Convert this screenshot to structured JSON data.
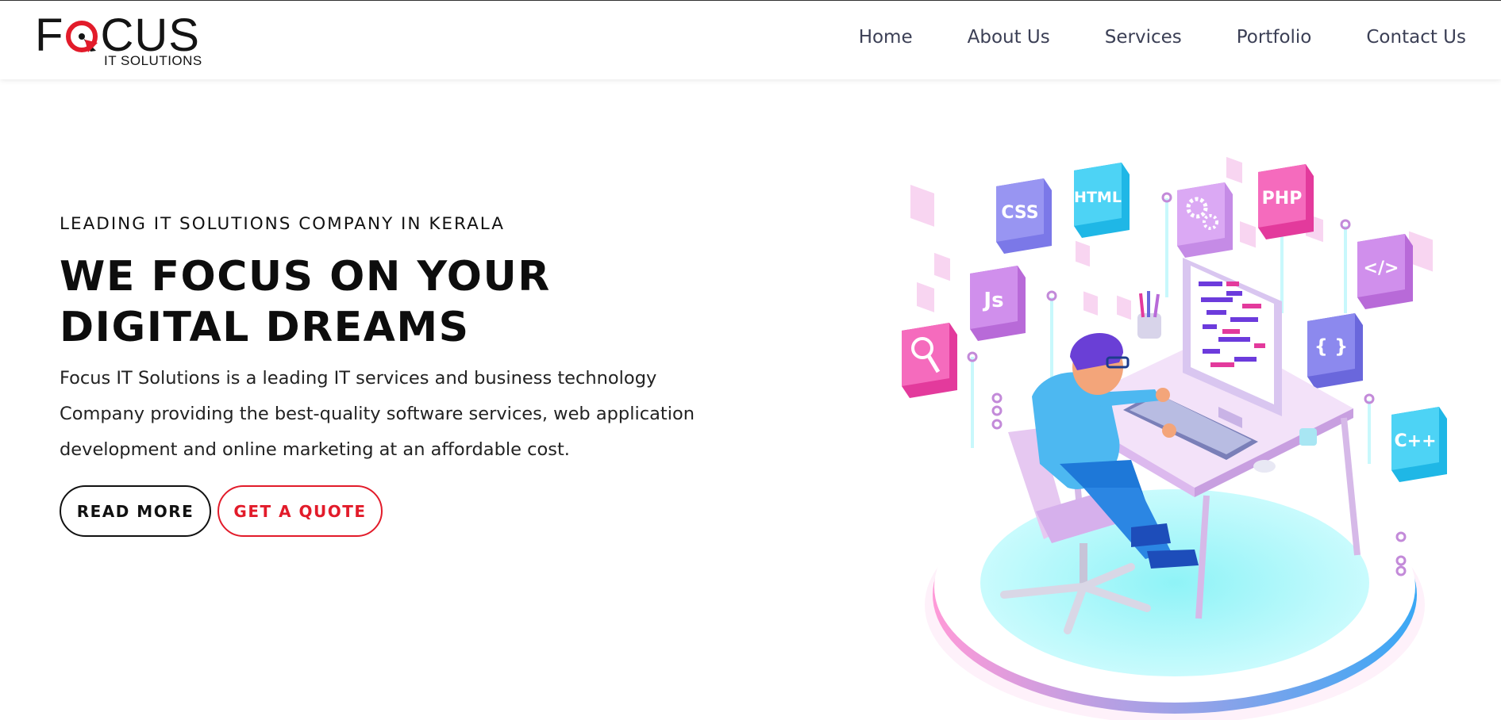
{
  "brand": {
    "logo_word": "FOCUS",
    "logo_sub": "IT SOLUTIONS",
    "accent_color": "#e21b2a",
    "text_color": "#141414"
  },
  "nav": {
    "items": [
      {
        "label": "Home"
      },
      {
        "label": "About Us"
      },
      {
        "label": "Services"
      },
      {
        "label": "Portfolio"
      },
      {
        "label": "Contact Us"
      }
    ]
  },
  "hero": {
    "eyebrow": "LEADING IT SOLUTIONS COMPANY IN KERALA",
    "headline_line1": "WE FOCUS ON YOUR",
    "headline_line2": "DIGITAL DREAMS",
    "description_line1": "Focus IT Solutions is a leading IT services and business technology",
    "description_line2": "Company providing the best-quality software services, web application",
    "description_line3": "development and online marketing at an affordable cost.",
    "read_more_label": "READ MORE",
    "get_quote_label": "GET A QUOTE"
  },
  "illustration": {
    "tiles": [
      "CSS",
      "HTML",
      "PHP",
      "Js",
      "{ }",
      "C++",
      "</>"
    ],
    "icons": [
      "gears-icon",
      "magnifier-icon",
      "developer-at-desk-icon"
    ]
  }
}
